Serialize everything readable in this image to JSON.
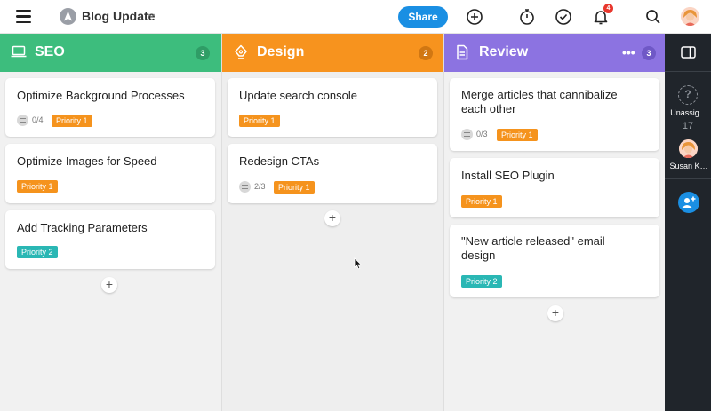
{
  "topbar": {
    "project_title": "Blog Update",
    "share_label": "Share",
    "notification_count": "4",
    "icons": [
      "hamburger-icon",
      "project-icon",
      "chevron-down-icon",
      "plus-circle-icon",
      "stopwatch-icon",
      "check-circle-icon",
      "bell-icon",
      "search-icon",
      "avatar"
    ]
  },
  "columns": [
    {
      "title": "SEO",
      "count": "3",
      "color": "#3dbd7d",
      "icon": "laptop-icon",
      "cards": [
        {
          "title": "Optimize Background Processes",
          "checklist": "0/4",
          "priority": "Priority 1"
        },
        {
          "title": "Optimize Images for Speed",
          "priority": "Priority 1"
        },
        {
          "title": "Add Tracking Parameters",
          "priority": "Priority 2"
        }
      ]
    },
    {
      "title": "Design",
      "count": "2",
      "color": "#f7931e",
      "icon": "pen-tool-icon",
      "cards": [
        {
          "title": "Update search console",
          "priority": "Priority 1"
        },
        {
          "title": "Redesign CTAs",
          "checklist": "2/3",
          "priority": "Priority 1"
        }
      ]
    },
    {
      "title": "Review",
      "count": "3",
      "color": "#8c73e1",
      "icon": "document-icon",
      "more": "•••",
      "cards": [
        {
          "title": "Merge articles that cannibalize each other",
          "checklist": "0/3",
          "priority": "Priority 1"
        },
        {
          "title": "Install SEO Plugin",
          "priority": "Priority 1"
        },
        {
          "title": "\"New article released\" email design",
          "priority": "Priority 2"
        }
      ]
    }
  ],
  "right_panel": {
    "unassigned_label": "Unassig…",
    "unassigned_count": "17",
    "user_label": "Susan K…"
  },
  "colors": {
    "share": "#1a8fe3",
    "priority_1": "#f5931d",
    "priority_2": "#2ab7b4",
    "panel_bg": "#20252b"
  }
}
